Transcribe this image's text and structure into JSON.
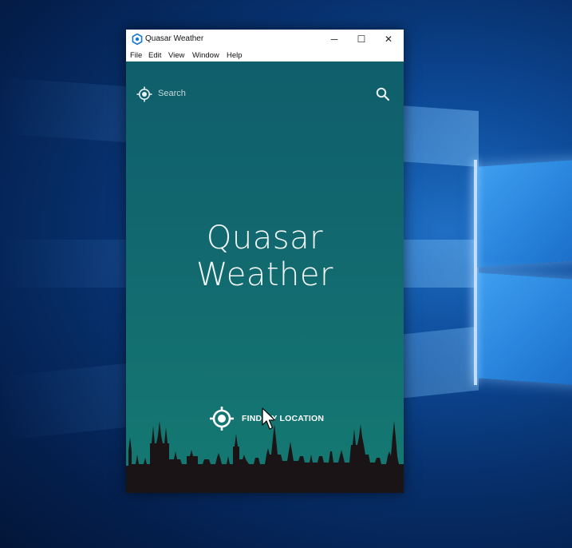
{
  "window": {
    "title": "Quasar Weather",
    "controls": {
      "minimize": "─",
      "maximize": "☐",
      "close": "✕"
    }
  },
  "menu": [
    "File",
    "Edit",
    "View",
    "Window",
    "Help"
  ],
  "search": {
    "placeholder": "Search"
  },
  "hero": {
    "line1": "Quasar",
    "line2": "Weather"
  },
  "find_location": {
    "label": "FIND MY LOCATION"
  },
  "icons": {
    "app": "quasar-logo-icon",
    "location": "crosshair-location-icon",
    "search": "magnifier-icon"
  },
  "colors": {
    "app_background_top": "#0f5e6c",
    "app_background_bottom": "#157a72",
    "skyline": "#1b1416",
    "desktop": "#0d4a98"
  }
}
